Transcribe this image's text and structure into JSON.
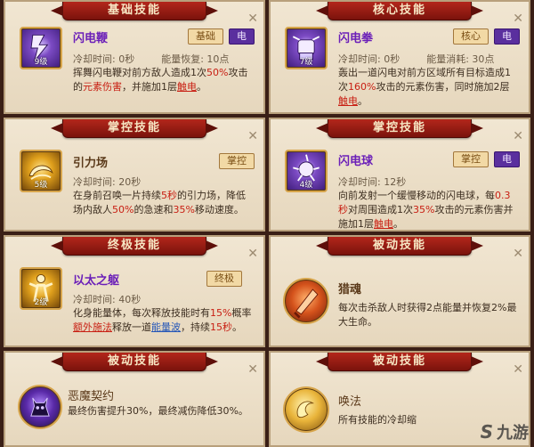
{
  "cards": [
    {
      "banner": "基础技能",
      "name": "闪电鞭",
      "level": "9级",
      "tags": [
        "基础",
        "电"
      ],
      "cooldown": "冷却时间: 0秒",
      "cost": "能量恢复: 10点",
      "desc_parts": [
        {
          "t": "挥舞闪电鞭对前方敌人造成1次"
        },
        {
          "t": "50%",
          "c": "hl"
        },
        {
          "t": "攻击的"
        },
        {
          "t": "元素伤害",
          "c": "hl"
        },
        {
          "t": "，并施加1层"
        },
        {
          "t": "触电",
          "c": "u"
        },
        {
          "t": "。"
        }
      ],
      "icon": "lightning-whip-icon"
    },
    {
      "banner": "核心技能",
      "name": "闪电拳",
      "level": "7级",
      "tags": [
        "核心",
        "电"
      ],
      "cooldown": "冷却时间: 0秒",
      "cost": "能量消耗: 30点",
      "desc_parts": [
        {
          "t": "轰出一道闪电对前方区域所有目标造成1次"
        },
        {
          "t": "160%",
          "c": "hl"
        },
        {
          "t": "攻击的元素伤害，同时施加2层"
        },
        {
          "t": "触电",
          "c": "u"
        },
        {
          "t": "。"
        }
      ],
      "icon": "lightning-fist-icon"
    },
    {
      "banner": "掌控技能",
      "name": "引力场",
      "level": "5级",
      "tags": [
        "掌控"
      ],
      "cooldown": "冷却时间: 20秒",
      "cost": "",
      "desc_parts": [
        {
          "t": "在身前召唤一片持续"
        },
        {
          "t": "5秒",
          "c": "hl"
        },
        {
          "t": "的引力场，降低场内敌人"
        },
        {
          "t": "50%",
          "c": "hl"
        },
        {
          "t": "的急速和"
        },
        {
          "t": "35%",
          "c": "hl"
        },
        {
          "t": "移动速度。"
        }
      ],
      "icon": "gravity-field-icon"
    },
    {
      "banner": "掌控技能",
      "name": "闪电球",
      "level": "4级",
      "tags": [
        "掌控",
        "电"
      ],
      "cooldown": "冷却时间: 12秒",
      "cost": "",
      "desc_parts": [
        {
          "t": "向前发射一个缓慢移动的闪电球，每"
        },
        {
          "t": "0.3秒",
          "c": "hl"
        },
        {
          "t": "对周围造成1次"
        },
        {
          "t": "35%",
          "c": "hl"
        },
        {
          "t": "攻击的元素伤害并施加1层"
        },
        {
          "t": "触电",
          "c": "u"
        },
        {
          "t": "。"
        }
      ],
      "icon": "lightning-ball-icon"
    },
    {
      "banner": "终极技能",
      "name": "以太之躯",
      "level": "2级",
      "tags": [
        "终极"
      ],
      "cooldown": "冷却时间: 40秒",
      "cost": "",
      "desc_parts": [
        {
          "t": "化身能量体，每次释放技能时有"
        },
        {
          "t": "15%",
          "c": "hl"
        },
        {
          "t": "概率"
        },
        {
          "t": "额外施法",
          "c": "u"
        },
        {
          "t": "释放一道"
        },
        {
          "t": "能量波",
          "c": "b"
        },
        {
          "t": "，持续"
        },
        {
          "t": "15秒",
          "c": "hl"
        },
        {
          "t": "。"
        }
      ],
      "icon": "ether-body-icon"
    },
    {
      "banner": "被动技能",
      "name": "猎魂",
      "level": "",
      "tags": [],
      "cooldown": "",
      "cost": "",
      "desc_parts": [
        {
          "t": "每次击杀敌人时获得2点能量并恢复2%最大生命。"
        }
      ],
      "icon": "soul-hunt-icon"
    },
    {
      "banner": "被动技能",
      "name": "恶魔契约",
      "level": "",
      "tags": [],
      "cooldown": "",
      "cost": "",
      "desc_parts": [
        {
          "t": "最终伤害提升30%，最终减伤降低30%。"
        }
      ],
      "icon": "demon-pact-icon"
    },
    {
      "banner": "被动技能",
      "name": "唤法",
      "level": "",
      "tags": [],
      "cooldown": "",
      "cost": "",
      "desc_parts": [
        {
          "t": "所有技能的冷却缩"
        }
      ],
      "icon": "summon-magic-icon"
    }
  ],
  "watermark": "九游",
  "colors": {
    "electric": "#5a2f9e",
    "highlight": "#c81e12",
    "banner": "#b3261b"
  }
}
